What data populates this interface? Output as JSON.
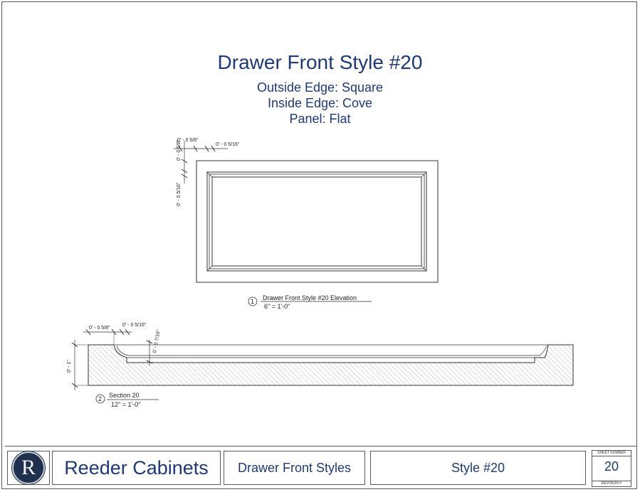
{
  "title": "Drawer Front Style #20",
  "specs": [
    "Outside Edge: Square",
    "Inside Edge: Cove",
    "Panel: Flat"
  ],
  "elevation": {
    "number": "1",
    "name": "Drawer Front Style #20 Elevation",
    "scale": "6\" = 1'-0\"",
    "dims": {
      "top_left": "0' - 0 5/8\"",
      "top_right": "0' - 0 5/16\"",
      "left_upper": "0' - 0 5/8\"",
      "left_lower": "0' - 0 5/16\""
    }
  },
  "section": {
    "number": "2",
    "name": "Section 20",
    "scale": "12\" = 1'-0\"",
    "dims": {
      "top_left": "0' - 0 5/8\"",
      "top_mid": "0' - 0 5/16\"",
      "diag": "0' - 0 7/16\"",
      "height": "0' - 1\""
    }
  },
  "footer": {
    "logo_letter": "R",
    "company": "Reeder Cabinets",
    "category": "Drawer Front Styles",
    "style": "Style #20",
    "sheet_number_label": "SHEET NUMBER",
    "sheet_number": "20",
    "revision_label": "REVISION #"
  },
  "colors": {
    "title_blue": "#1f3a73",
    "logo_navy": "#20304f"
  }
}
